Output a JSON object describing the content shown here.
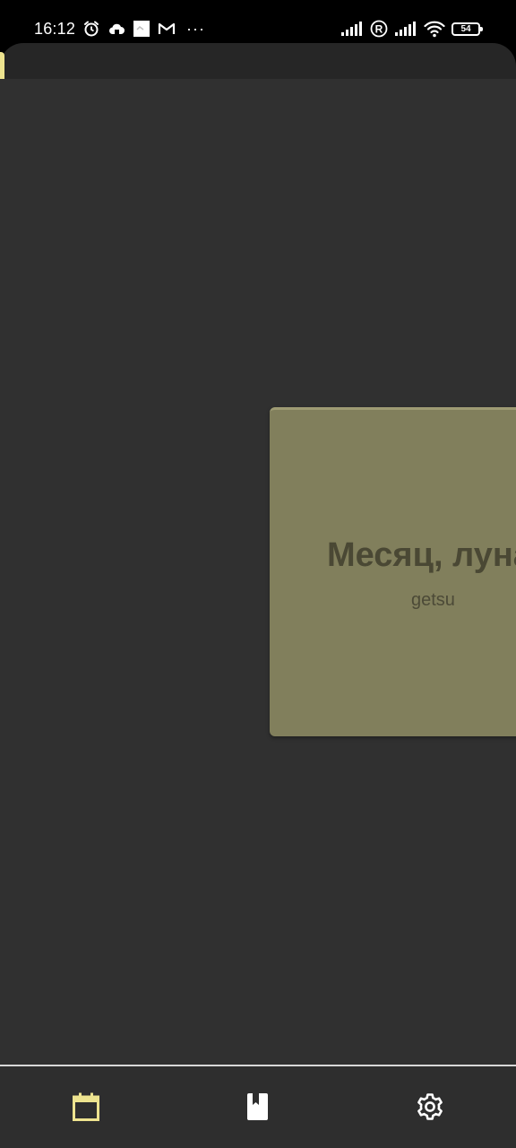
{
  "status_bar": {
    "time": "16:12",
    "battery_level": "54",
    "overflow_indicator": "···",
    "left_icons": [
      "alarm-icon",
      "cloud-icon",
      "image-notification-icon",
      "gmail-icon"
    ],
    "right_icons": [
      "signal-icon",
      "roaming-icon",
      "signal-icon",
      "wifi-icon",
      "battery-icon"
    ]
  },
  "card": {
    "word": "Месяц, луна",
    "reading": "getsu"
  },
  "bottom_nav": {
    "items": [
      {
        "name": "calendar",
        "icon": "calendar-icon",
        "active": true
      },
      {
        "name": "book",
        "icon": "bookmark-book-icon",
        "active": false
      },
      {
        "name": "settings",
        "icon": "gear-icon",
        "active": false
      }
    ]
  },
  "colors": {
    "accent": "#ede38f",
    "card_background": "#817f5c",
    "screen_background": "#303030",
    "nav_background": "#2e2e2e"
  }
}
